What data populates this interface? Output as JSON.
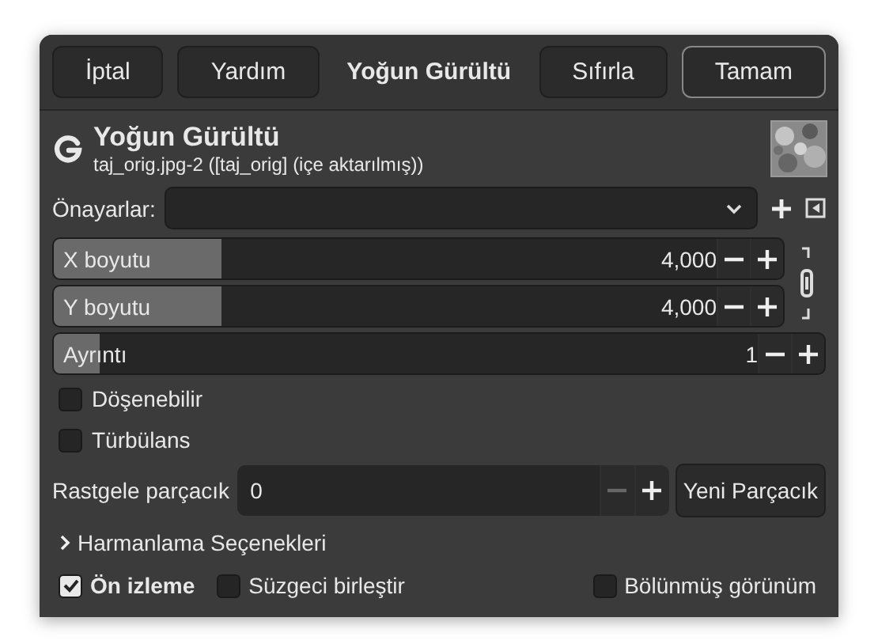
{
  "header": {
    "title": "Yoğun Gürültü",
    "left_buttons": [
      {
        "label": "İptal",
        "default": false
      },
      {
        "label": "Yardım",
        "default": false
      }
    ],
    "right_buttons": [
      {
        "label": "Sıfırla",
        "default": false
      },
      {
        "label": "Tamam",
        "default": true
      }
    ]
  },
  "filter": {
    "title": "Yoğun Gürültü",
    "subtitle": "taj_orig.jpg-2 ([taj_orig] (içe aktarılmış))"
  },
  "presets": {
    "label": "Önayarlar:"
  },
  "linked_sliders": [
    {
      "label": "X boyutu",
      "value": "4,000",
      "level": 0.23
    },
    {
      "label": "Y boyutu",
      "value": "4,000",
      "level": 0.23
    }
  ],
  "detail_slider": {
    "label": "Ayrıntı",
    "value": "1",
    "level": 0.06
  },
  "checkboxes": [
    {
      "label": "Döşenebilir",
      "checked": false
    },
    {
      "label": "Türbülans",
      "checked": false
    }
  ],
  "seed": {
    "label": "Rastgele parçacık",
    "value": "0",
    "minus_disabled": true,
    "button": "Yeni Parçacık"
  },
  "expander": {
    "label": "Harmanlama Seçenekleri",
    "expanded": false
  },
  "footer": [
    {
      "label": "Ön izleme",
      "checked": true
    },
    {
      "label": "Süzgeci birleştir",
      "checked": false
    },
    {
      "label": "Bölünmüş görünüm",
      "checked": false
    }
  ]
}
